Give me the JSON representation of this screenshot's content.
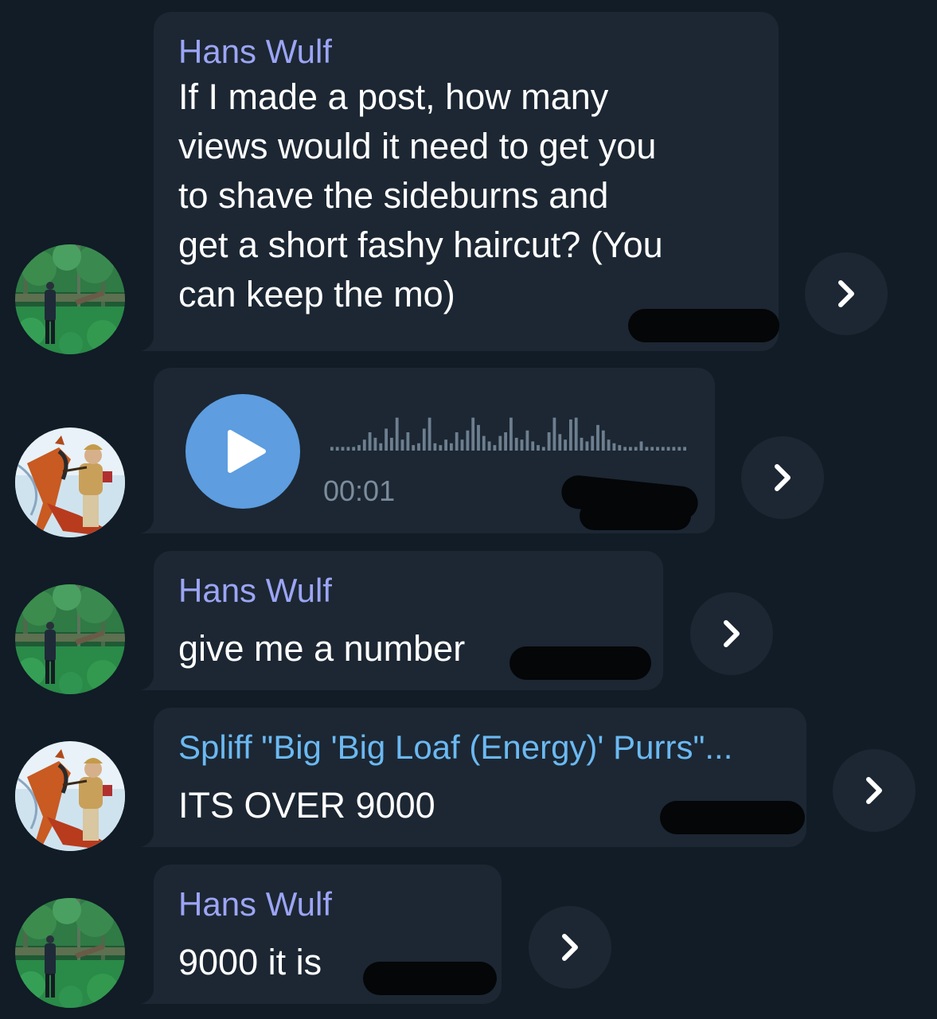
{
  "colors": {
    "background": "#111c26",
    "bubble": "#1c2733",
    "sender_hans": "#9ca5f5",
    "sender_spliff": "#6bb9f2",
    "play_button": "#5d9de0",
    "redaction": "#050608"
  },
  "messages": [
    {
      "sender": "Hans Wulf",
      "avatar": "forest-figure-avatar",
      "lines": [
        "If I made a post, how many",
        "views would it need to get you",
        "to shave the sideburns and",
        "get a short fashy haircut? (You",
        "can keep the mo)"
      ]
    },
    {
      "sender": "",
      "avatar": "horse-rider-avatar",
      "type": "voice",
      "duration": "00:01",
      "waveform_levels": [
        0.1,
        0.1,
        0.1,
        0.1,
        0.1,
        0.15,
        0.3,
        0.5,
        0.35,
        0.2,
        0.6,
        0.35,
        0.9,
        0.3,
        0.5,
        0.15,
        0.2,
        0.6,
        0.9,
        0.2,
        0.15,
        0.3,
        0.2,
        0.5,
        0.3,
        0.55,
        0.9,
        0.7,
        0.4,
        0.25,
        0.15,
        0.4,
        0.5,
        0.9,
        0.35,
        0.3,
        0.55,
        0.25,
        0.15,
        0.1,
        0.5,
        0.9,
        0.45,
        0.3,
        0.85,
        0.9,
        0.35,
        0.25,
        0.4,
        0.7,
        0.55,
        0.3,
        0.2,
        0.15,
        0.1,
        0.1,
        0.1,
        0.25,
        0.1,
        0.1,
        0.1,
        0.1,
        0.1,
        0.1,
        0.1,
        0.1
      ]
    },
    {
      "sender": "Hans Wulf",
      "avatar": "forest-figure-avatar",
      "lines": [
        "give me a number"
      ]
    },
    {
      "sender": "Spliff \"Big 'Big Loaf (Energy)' Purrs\"...",
      "avatar": "horse-rider-avatar",
      "lines": [
        "ITS OVER 9000"
      ]
    },
    {
      "sender": "Hans Wulf",
      "avatar": "forest-figure-avatar",
      "lines": [
        "9000 it is"
      ]
    }
  ],
  "icons": {
    "forward": "chevron-right-icon",
    "play": "play-icon"
  }
}
